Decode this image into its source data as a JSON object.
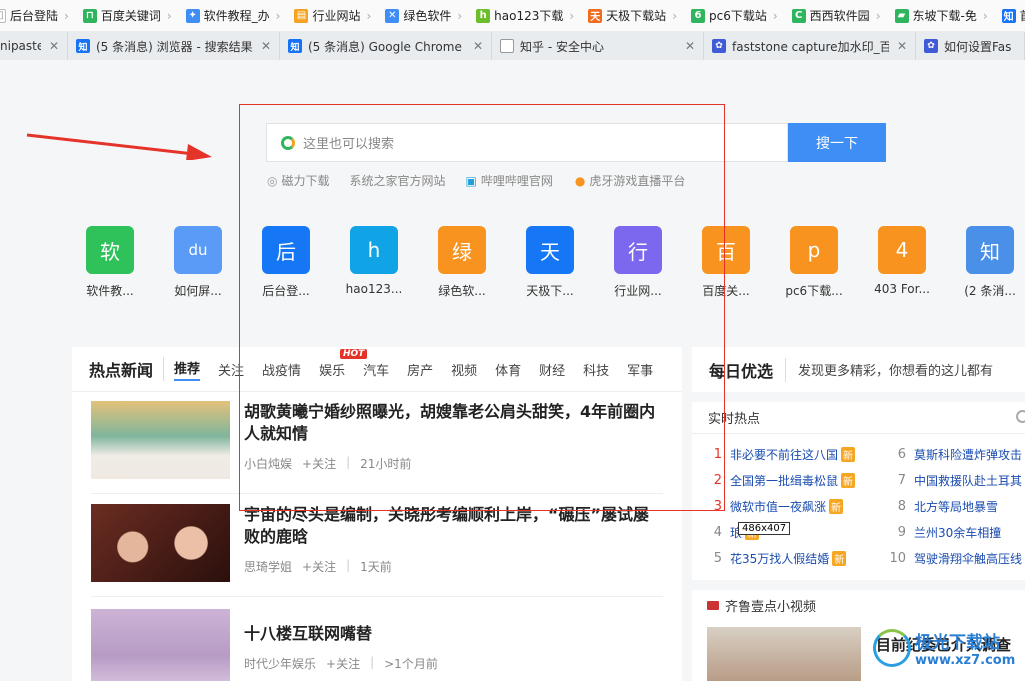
{
  "bookmarks": [
    {
      "label": "后台登陆",
      "icon": "page-icon",
      "color": "#ffffff"
    },
    {
      "label": "百度关键词",
      "icon": "ruler-icon",
      "color": "#2fb55d"
    },
    {
      "label": "软件教程_办",
      "icon": "gear-icon",
      "color": "#3f8ef5"
    },
    {
      "label": "行业网站",
      "icon": "doc-icon",
      "color": "#f4a21f"
    },
    {
      "label": "绿色软件",
      "icon": "x-icon",
      "color": "#3f8ef5"
    },
    {
      "label": "hao123下载",
      "icon": "hao-icon",
      "color": "#6bbd2c"
    },
    {
      "label": "天极下载站",
      "icon": "tian-icon",
      "color": "#f26b1d"
    },
    {
      "label": "pc6下载站",
      "icon": "pc6-icon",
      "color": "#2fb55d"
    },
    {
      "label": "西西软件园",
      "icon": "cc-icon",
      "color": "#2fb55d"
    },
    {
      "label": "东坡下载-免",
      "icon": "leaf-icon",
      "color": "#2fb55d"
    },
    {
      "label": "首页 - 知乎",
      "icon": "zhihu-icon",
      "color": "#1772f6"
    }
  ],
  "tabs": [
    {
      "label": "nipaste",
      "icon": "none",
      "color": "#e9ecef"
    },
    {
      "label": "(5 条消息) 浏览器 - 搜索结果",
      "icon": "zhihu-icon",
      "color": "#1772f6"
    },
    {
      "label": "(5 条消息) Google Chrome",
      "icon": "zhihu-icon",
      "color": "#1772f6"
    },
    {
      "label": "知乎 - 安全中心",
      "icon": "page-icon",
      "color": "#ffffff"
    },
    {
      "label": "faststone capture加水印_百",
      "icon": "baidu-icon",
      "color": "#3f5bd5"
    },
    {
      "label": "如何设置Fas",
      "icon": "baidu-icon",
      "color": "#3f5bd5"
    }
  ],
  "search": {
    "placeholder": "这里也可以搜索",
    "button": "搜一下",
    "hotlinks": [
      {
        "label": "磁力下载",
        "icon": "target-icon"
      },
      {
        "label": "系统之家官方网站",
        "icon": "none"
      },
      {
        "label": "哔哩哔哩官网",
        "icon": "bilibili-icon"
      },
      {
        "label": "虎牙游戏直播平台",
        "icon": "huya-icon"
      }
    ]
  },
  "shortcuts": [
    {
      "char": "软",
      "label": "软件教...",
      "color": "#2fc25b"
    },
    {
      "char": "du",
      "label": "如何屏...",
      "color": "#5b9bf8"
    },
    {
      "char": "后",
      "label": "后台登...",
      "color": "#1677f6"
    },
    {
      "char": "h",
      "label": "hao123...",
      "color": "#10a3e6"
    },
    {
      "char": "绿",
      "label": "绿色软...",
      "color": "#f7931e"
    },
    {
      "char": "天",
      "label": "天极下...",
      "color": "#1677f6"
    },
    {
      "char": "行",
      "label": "行业网...",
      "color": "#7b68ee"
    },
    {
      "char": "百",
      "label": "百度关...",
      "color": "#f7931e"
    },
    {
      "char": "p",
      "label": "pc6下载...",
      "color": "#f7931e"
    },
    {
      "char": "4",
      "label": "403 For...",
      "color": "#f7931e"
    },
    {
      "char": "知",
      "label": "(2 条消...",
      "color": "#4a90e8"
    }
  ],
  "news": {
    "title": "热点新闻",
    "tabs": [
      "推荐",
      "关注",
      "战疫情",
      "娱乐",
      "汽车",
      "房产",
      "视频",
      "体育",
      "财经",
      "科技",
      "军事"
    ],
    "active_tab": "推荐",
    "hot_badge": "HOT",
    "articles": [
      {
        "title": "胡歌黄曦宁婚纱照曝光，胡嫂靠老公肩头甜笑，4年前圈内人就知情",
        "source": "小白炖娱",
        "follow": "+关注",
        "time": "21小时前",
        "thumb_color": "#6ba88a"
      },
      {
        "title": "宇宙的尽头是编制，关晓彤考编顺利上岸，“碾压”屡试屡败的鹿晗",
        "source": "思琦学姐",
        "follow": "+关注",
        "time": "1天前",
        "thumb_color": "#5a2a20"
      },
      {
        "title": "十八楼互联网嘴替",
        "source": "时代少年娱乐",
        "follow": "+关注",
        "time": ">1个月前",
        "thumb_color": "#c4a9cf"
      }
    ]
  },
  "daily": {
    "title": "每日优选",
    "subtitle": "发现更多精彩，你想看的这儿都有"
  },
  "realtime": {
    "title": "实时热点",
    "items": [
      {
        "rank": "1",
        "text": "非必要不前往这八国",
        "new": "新"
      },
      {
        "rank": "2",
        "text": "全国第一批缉毒松鼠",
        "new": "新"
      },
      {
        "rank": "3",
        "text": "微软市值一夜飙涨",
        "new": "新"
      },
      {
        "rank": "4",
        "text": "琅",
        "new": "新"
      },
      {
        "rank": "5",
        "text": "花35万找人假结婚",
        "new": "新"
      },
      {
        "rank": "6",
        "text": "莫斯科险遭炸弹攻击",
        "new": ""
      },
      {
        "rank": "7",
        "text": "中国救援队赴土耳其",
        "new": ""
      },
      {
        "rank": "8",
        "text": "北方等局地暴雪",
        "new": ""
      },
      {
        "rank": "9",
        "text": "兰州30余车相撞",
        "new": ""
      },
      {
        "rank": "10",
        "text": "驾驶滑翔伞触高压线",
        "new": ""
      }
    ]
  },
  "video": {
    "title": "齐鲁壹点小视频",
    "caption": "目前纪委已介入调查"
  },
  "selection": {
    "size_label": "486x407"
  },
  "watermark": {
    "name": "极光下载站",
    "url": "www.xz7.com"
  },
  "colors": {
    "accent": "#3f8ef5",
    "annotation": "#e5332a"
  }
}
